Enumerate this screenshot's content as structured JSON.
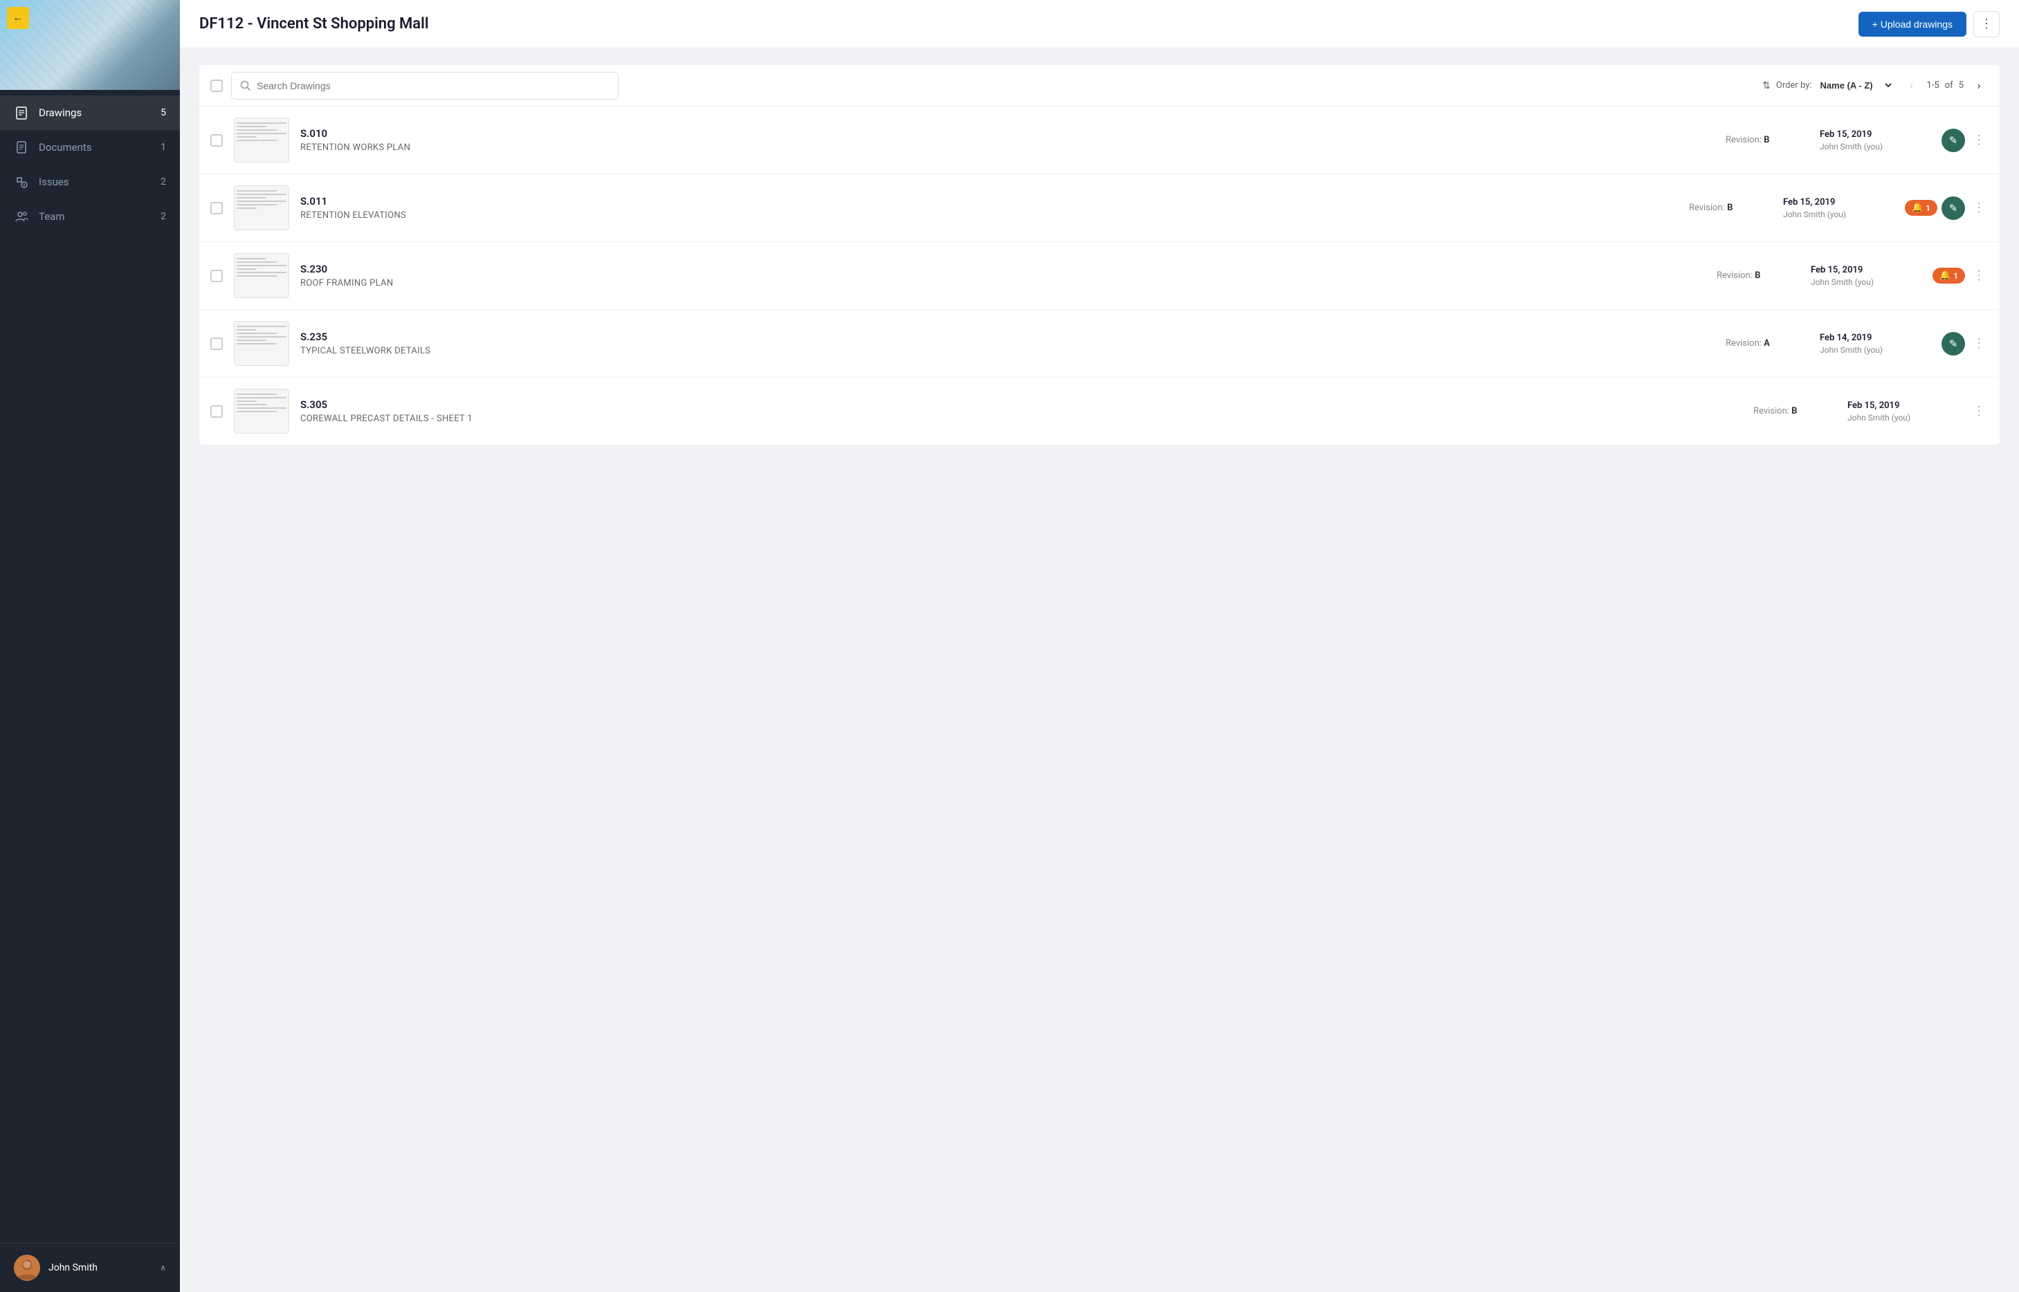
{
  "sidebar": {
    "back_label": "←",
    "nav_items": [
      {
        "id": "drawings",
        "label": "Drawings",
        "badge": "5",
        "active": true
      },
      {
        "id": "documents",
        "label": "Documents",
        "badge": "1",
        "active": false
      },
      {
        "id": "issues",
        "label": "Issues",
        "badge": "2",
        "active": false
      },
      {
        "id": "team",
        "label": "Team",
        "badge": "2",
        "active": false
      }
    ],
    "user": {
      "name": "John Smith",
      "chevron": "∧"
    }
  },
  "header": {
    "title": "DF112 - Vincent St Shopping Mall",
    "upload_button": "+ Upload drawings",
    "more_button": "⋮"
  },
  "toolbar": {
    "search_placeholder": "Search Drawings",
    "sort_label": "Order by:",
    "sort_value": "Name (A - Z)",
    "pagination": {
      "current": "1-5",
      "of_label": "of",
      "total": "5"
    }
  },
  "drawings": [
    {
      "code": "S.010",
      "name": "RETENTION WORKS PLAN",
      "revision": "B",
      "date": "Feb 15, 2019",
      "user": "John Smith (you)",
      "alert_count": null,
      "has_edit": true
    },
    {
      "code": "S.011",
      "name": "RETENTION ELEVATIONS",
      "revision": "B",
      "date": "Feb 15, 2019",
      "user": "John Smith (you)",
      "alert_count": 1,
      "has_edit": true
    },
    {
      "code": "S.230",
      "name": "ROOF FRAMING PLAN",
      "revision": "B",
      "date": "Feb 15, 2019",
      "user": "John Smith (you)",
      "alert_count": 1,
      "has_edit": false
    },
    {
      "code": "S.235",
      "name": "TYPICAL STEELWORK DETAILS",
      "revision": "A",
      "date": "Feb 14, 2019",
      "user": "John Smith (you)",
      "alert_count": null,
      "has_edit": true
    },
    {
      "code": "S.305",
      "name": "COREWALL PRECAST DETAILS - SHEET 1",
      "revision": "B",
      "date": "Feb 15, 2019",
      "user": "John Smith (you)",
      "alert_count": null,
      "has_edit": false
    }
  ],
  "labels": {
    "revision_prefix": "Revision:",
    "edit_icon": "✎",
    "alert_icon": "🔔",
    "more_icon": "⋮",
    "sort_arrows": "⇅"
  }
}
